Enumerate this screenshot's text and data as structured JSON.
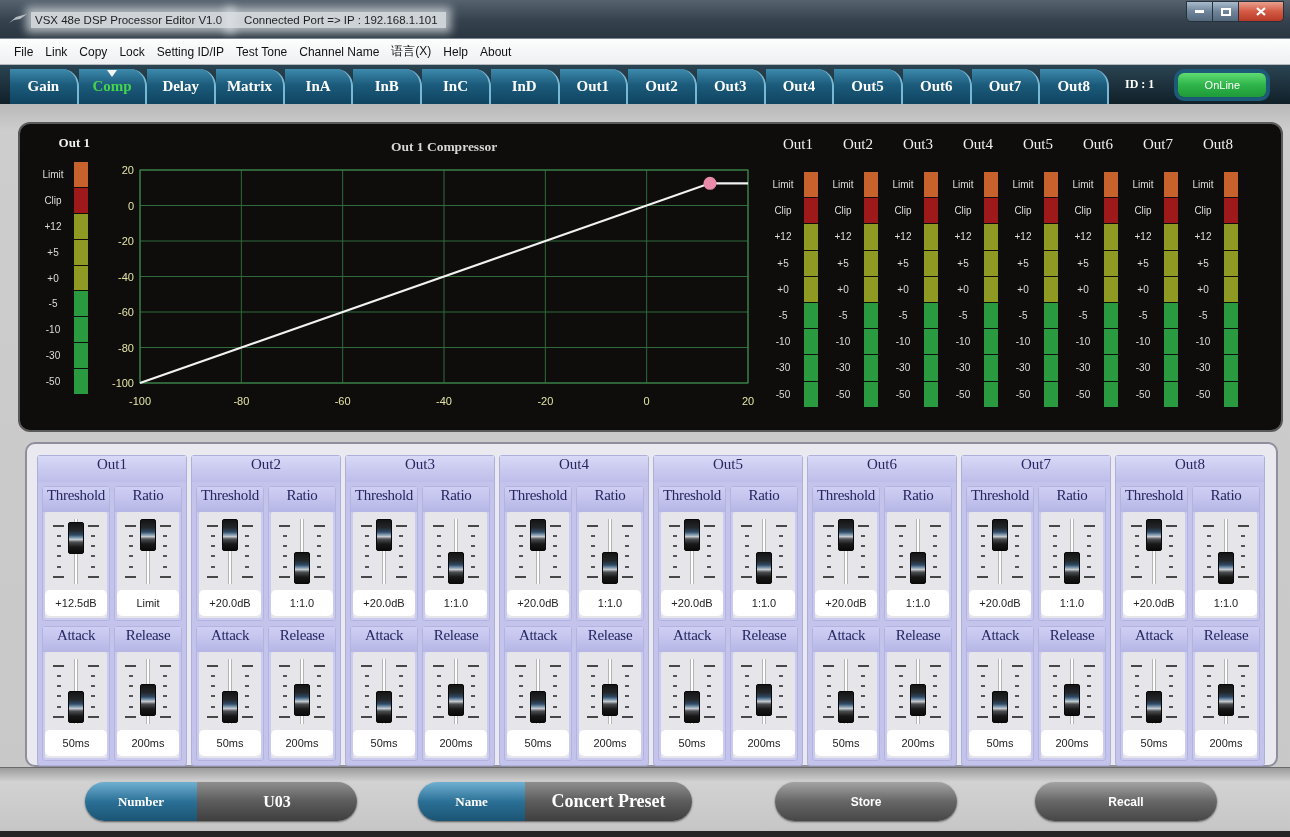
{
  "window": {
    "title": "VSX 48e DSP Processor Editor V1.0",
    "connection": "Connected Port => IP : 192.168.1.101"
  },
  "menu": [
    "File",
    "Link",
    "Copy",
    "Lock",
    "Setting ID/IP",
    "Test Tone",
    "Channel Name",
    "语言(X)",
    "Help",
    "About"
  ],
  "tabs": [
    {
      "label": "Gain",
      "selected": false
    },
    {
      "label": "Comp",
      "selected": true
    },
    {
      "label": "Delay",
      "selected": false
    },
    {
      "label": "Matrix",
      "selected": false
    },
    {
      "label": "InA",
      "selected": false
    },
    {
      "label": "InB",
      "selected": false
    },
    {
      "label": "InC",
      "selected": false
    },
    {
      "label": "InD",
      "selected": false
    },
    {
      "label": "Out1",
      "selected": false
    },
    {
      "label": "Out2",
      "selected": false
    },
    {
      "label": "Out3",
      "selected": false
    },
    {
      "label": "Out4",
      "selected": false
    },
    {
      "label": "Out5",
      "selected": false
    },
    {
      "label": "Out6",
      "selected": false
    },
    {
      "label": "Out7",
      "selected": false
    },
    {
      "label": "Out8",
      "selected": false
    }
  ],
  "device": {
    "id": "ID : 1",
    "status": "OnLine",
    "online": true
  },
  "compressor_view": {
    "meter": {
      "name": "Out 1",
      "scale": [
        {
          "label": "Limit",
          "color": "#c8622c"
        },
        {
          "label": "Clip",
          "color": "#9e1a1a"
        },
        {
          "label": "+12",
          "color": "#8f9a22"
        },
        {
          "label": "+5",
          "color": "#8f9a22"
        },
        {
          "label": "+0",
          "color": "#8f9a22"
        },
        {
          "label": "-5",
          "color": "#2a9a40"
        },
        {
          "label": "-10",
          "color": "#2a9a40"
        },
        {
          "label": "-30",
          "color": "#2a9a40"
        },
        {
          "label": "-50",
          "color": "#2a9a40"
        }
      ]
    },
    "chart_data": {
      "type": "line",
      "title": "Out 1 Compressor",
      "xlim": [
        -100,
        20
      ],
      "ylim": [
        -100,
        20
      ],
      "xticks": [
        -100,
        -80,
        -60,
        -40,
        -20,
        0,
        20
      ],
      "yticks": [
        20,
        0,
        -20,
        -40,
        -60,
        -80,
        -100
      ],
      "grid": true,
      "series": [
        {
          "type": "line",
          "color": "#f2f2f2",
          "x": [
            -100,
            12.5,
            20
          ],
          "values": [
            -100,
            12.5,
            12.5
          ]
        },
        {
          "type": "scatter",
          "color": "#e98aab",
          "x": [
            12.5
          ],
          "values": [
            12.5
          ]
        }
      ]
    }
  },
  "output_meters": [
    {
      "name": "Out1",
      "scale": [
        {
          "label": "Limit",
          "color": "#c8622c"
        },
        {
          "label": "Clip",
          "color": "#9e1a1a"
        },
        {
          "label": "+12",
          "color": "#8f9a22"
        },
        {
          "label": "+5",
          "color": "#8f9a22"
        },
        {
          "label": "+0",
          "color": "#8f9a22"
        },
        {
          "label": "-5",
          "color": "#2a9a40"
        },
        {
          "label": "-10",
          "color": "#2a9a40"
        },
        {
          "label": "-30",
          "color": "#2a9a40"
        },
        {
          "label": "-50",
          "color": "#2a9a40"
        }
      ]
    },
    {
      "name": "Out2",
      "scale": [
        {
          "label": "Limit",
          "color": "#c8622c"
        },
        {
          "label": "Clip",
          "color": "#9e1a1a"
        },
        {
          "label": "+12",
          "color": "#8f9a22"
        },
        {
          "label": "+5",
          "color": "#8f9a22"
        },
        {
          "label": "+0",
          "color": "#8f9a22"
        },
        {
          "label": "-5",
          "color": "#2a9a40"
        },
        {
          "label": "-10",
          "color": "#2a9a40"
        },
        {
          "label": "-30",
          "color": "#2a9a40"
        },
        {
          "label": "-50",
          "color": "#2a9a40"
        }
      ]
    },
    {
      "name": "Out3",
      "scale": [
        {
          "label": "Limit",
          "color": "#c8622c"
        },
        {
          "label": "Clip",
          "color": "#9e1a1a"
        },
        {
          "label": "+12",
          "color": "#8f9a22"
        },
        {
          "label": "+5",
          "color": "#8f9a22"
        },
        {
          "label": "+0",
          "color": "#8f9a22"
        },
        {
          "label": "-5",
          "color": "#2a9a40"
        },
        {
          "label": "-10",
          "color": "#2a9a40"
        },
        {
          "label": "-30",
          "color": "#2a9a40"
        },
        {
          "label": "-50",
          "color": "#2a9a40"
        }
      ]
    },
    {
      "name": "Out4",
      "scale": [
        {
          "label": "Limit",
          "color": "#c8622c"
        },
        {
          "label": "Clip",
          "color": "#9e1a1a"
        },
        {
          "label": "+12",
          "color": "#8f9a22"
        },
        {
          "label": "+5",
          "color": "#8f9a22"
        },
        {
          "label": "+0",
          "color": "#8f9a22"
        },
        {
          "label": "-5",
          "color": "#2a9a40"
        },
        {
          "label": "-10",
          "color": "#2a9a40"
        },
        {
          "label": "-30",
          "color": "#2a9a40"
        },
        {
          "label": "-50",
          "color": "#2a9a40"
        }
      ]
    },
    {
      "name": "Out5",
      "scale": [
        {
          "label": "Limit",
          "color": "#c8622c"
        },
        {
          "label": "Clip",
          "color": "#9e1a1a"
        },
        {
          "label": "+12",
          "color": "#8f9a22"
        },
        {
          "label": "+5",
          "color": "#8f9a22"
        },
        {
          "label": "+0",
          "color": "#8f9a22"
        },
        {
          "label": "-5",
          "color": "#2a9a40"
        },
        {
          "label": "-10",
          "color": "#2a9a40"
        },
        {
          "label": "-30",
          "color": "#2a9a40"
        },
        {
          "label": "-50",
          "color": "#2a9a40"
        }
      ]
    },
    {
      "name": "Out6",
      "scale": [
        {
          "label": "Limit",
          "color": "#c8622c"
        },
        {
          "label": "Clip",
          "color": "#9e1a1a"
        },
        {
          "label": "+12",
          "color": "#8f9a22"
        },
        {
          "label": "+5",
          "color": "#8f9a22"
        },
        {
          "label": "+0",
          "color": "#8f9a22"
        },
        {
          "label": "-5",
          "color": "#2a9a40"
        },
        {
          "label": "-10",
          "color": "#2a9a40"
        },
        {
          "label": "-30",
          "color": "#2a9a40"
        },
        {
          "label": "-50",
          "color": "#2a9a40"
        }
      ]
    },
    {
      "name": "Out7",
      "scale": [
        {
          "label": "Limit",
          "color": "#c8622c"
        },
        {
          "label": "Clip",
          "color": "#9e1a1a"
        },
        {
          "label": "+12",
          "color": "#8f9a22"
        },
        {
          "label": "+5",
          "color": "#8f9a22"
        },
        {
          "label": "+0",
          "color": "#8f9a22"
        },
        {
          "label": "-5",
          "color": "#2a9a40"
        },
        {
          "label": "-10",
          "color": "#2a9a40"
        },
        {
          "label": "-30",
          "color": "#2a9a40"
        },
        {
          "label": "-50",
          "color": "#2a9a40"
        }
      ]
    },
    {
      "name": "Out8",
      "scale": [
        {
          "label": "Limit",
          "color": "#c8622c"
        },
        {
          "label": "Clip",
          "color": "#9e1a1a"
        },
        {
          "label": "+12",
          "color": "#8f9a22"
        },
        {
          "label": "+5",
          "color": "#8f9a22"
        },
        {
          "label": "+0",
          "color": "#8f9a22"
        },
        {
          "label": "-5",
          "color": "#2a9a40"
        },
        {
          "label": "-10",
          "color": "#2a9a40"
        },
        {
          "label": "-30",
          "color": "#2a9a40"
        },
        {
          "label": "-50",
          "color": "#2a9a40"
        }
      ]
    }
  ],
  "channels": [
    {
      "name": "Out1",
      "controls": [
        {
          "label": "Threshold",
          "level": 0.9,
          "value": "+12.5dB"
        },
        {
          "label": "Ratio",
          "level": 1,
          "value": "Limit"
        },
        {
          "label": "Attack",
          "level": 0.03,
          "value": "50ms"
        },
        {
          "label": "Release",
          "level": 0.25,
          "value": "200ms"
        }
      ]
    },
    {
      "name": "Out2",
      "controls": [
        {
          "label": "Threshold",
          "level": 1,
          "value": "+20.0dB"
        },
        {
          "label": "Ratio",
          "level": 0,
          "value": "1:1.0"
        },
        {
          "label": "Attack",
          "level": 0.03,
          "value": "50ms"
        },
        {
          "label": "Release",
          "level": 0.25,
          "value": "200ms"
        }
      ]
    },
    {
      "name": "Out3",
      "controls": [
        {
          "label": "Threshold",
          "level": 1,
          "value": "+20.0dB"
        },
        {
          "label": "Ratio",
          "level": 0,
          "value": "1:1.0"
        },
        {
          "label": "Attack",
          "level": 0.03,
          "value": "50ms"
        },
        {
          "label": "Release",
          "level": 0.25,
          "value": "200ms"
        }
      ]
    },
    {
      "name": "Out4",
      "controls": [
        {
          "label": "Threshold",
          "level": 1,
          "value": "+20.0dB"
        },
        {
          "label": "Ratio",
          "level": 0,
          "value": "1:1.0"
        },
        {
          "label": "Attack",
          "level": 0.03,
          "value": "50ms"
        },
        {
          "label": "Release",
          "level": 0.25,
          "value": "200ms"
        }
      ]
    },
    {
      "name": "Out5",
      "controls": [
        {
          "label": "Threshold",
          "level": 1,
          "value": "+20.0dB"
        },
        {
          "label": "Ratio",
          "level": 0,
          "value": "1:1.0"
        },
        {
          "label": "Attack",
          "level": 0.03,
          "value": "50ms"
        },
        {
          "label": "Release",
          "level": 0.25,
          "value": "200ms"
        }
      ]
    },
    {
      "name": "Out6",
      "controls": [
        {
          "label": "Threshold",
          "level": 1,
          "value": "+20.0dB"
        },
        {
          "label": "Ratio",
          "level": 0,
          "value": "1:1.0"
        },
        {
          "label": "Attack",
          "level": 0.03,
          "value": "50ms"
        },
        {
          "label": "Release",
          "level": 0.25,
          "value": "200ms"
        }
      ]
    },
    {
      "name": "Out7",
      "controls": [
        {
          "label": "Threshold",
          "level": 1,
          "value": "+20.0dB"
        },
        {
          "label": "Ratio",
          "level": 0,
          "value": "1:1.0"
        },
        {
          "label": "Attack",
          "level": 0.03,
          "value": "50ms"
        },
        {
          "label": "Release",
          "level": 0.25,
          "value": "200ms"
        }
      ]
    },
    {
      "name": "Out8",
      "controls": [
        {
          "label": "Threshold",
          "level": 1,
          "value": "+20.0dB"
        },
        {
          "label": "Ratio",
          "level": 0,
          "value": "1:1.0"
        },
        {
          "label": "Attack",
          "level": 0.03,
          "value": "50ms"
        },
        {
          "label": "Release",
          "level": 0.25,
          "value": "200ms"
        }
      ]
    }
  ],
  "footer": {
    "number": {
      "label": "Number",
      "value": "U03"
    },
    "name": {
      "label": "Name",
      "value": "Concert Preset"
    },
    "buttons": [
      "Store",
      "Recall"
    ]
  }
}
